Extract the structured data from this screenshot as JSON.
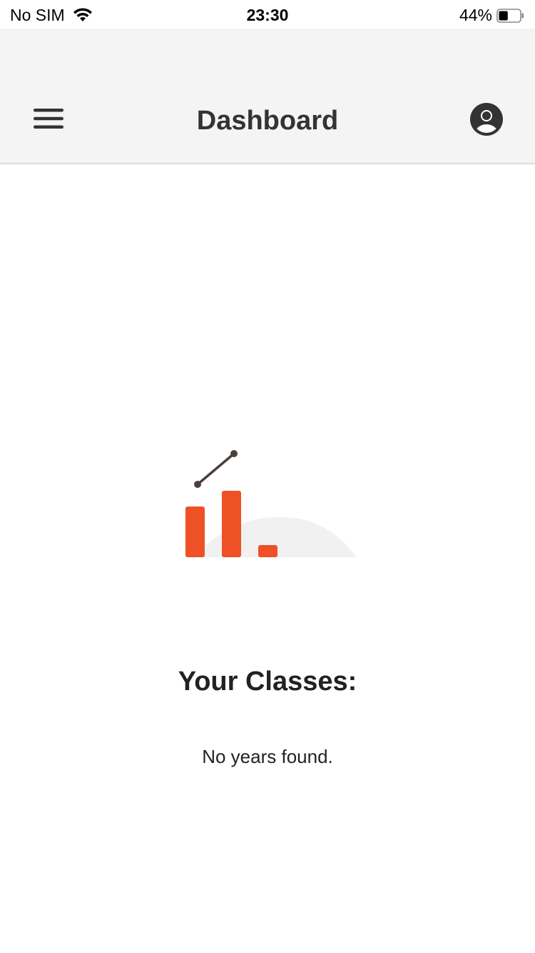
{
  "status_bar": {
    "carrier": "No SIM",
    "time": "23:30",
    "battery_percent": "44%",
    "battery_level": 0.44,
    "wifi_icon": "wifi-icon",
    "battery_icon": "battery-icon"
  },
  "header": {
    "title": "Dashboard",
    "menu_icon": "hamburger-menu-icon",
    "profile_icon": "user-profile-icon"
  },
  "main": {
    "illustration_icon": "bar-chart-illustration-icon",
    "section_title": "Your Classes:",
    "empty_message": "No years found."
  },
  "colors": {
    "accent": "#ee5125",
    "navbar_bg": "#f4f4f4",
    "title_text": "#333333",
    "illustration_line": "#4a3f3a",
    "illustration_bg": "#f1f1f1"
  }
}
